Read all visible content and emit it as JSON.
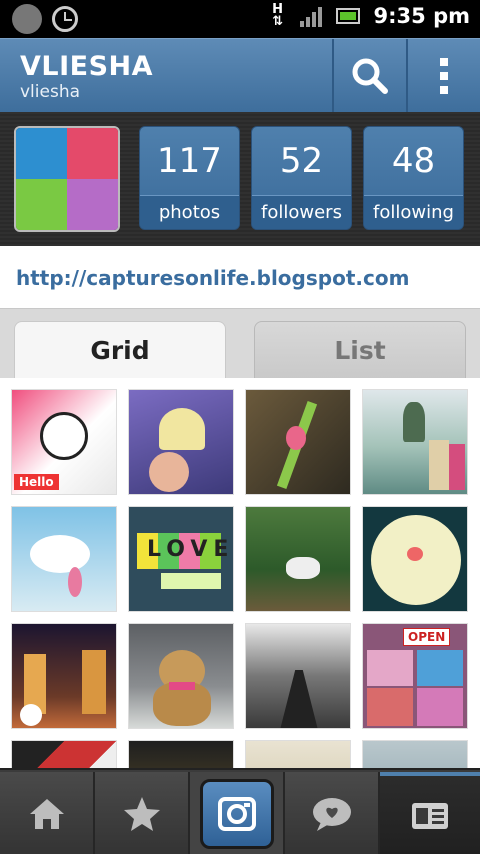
{
  "status_bar": {
    "network": "H",
    "time": "9:35 pm",
    "icons": [
      "smiley-icon",
      "alarm-clock-icon",
      "data-arrows-icon",
      "signal-icon",
      "battery-icon"
    ]
  },
  "header": {
    "display_name": "VLIESHA",
    "username": "vliesha",
    "icons": [
      "search-icon",
      "overflow-menu-icon"
    ],
    "color": "#4a7aaa"
  },
  "profile": {
    "stats": [
      {
        "count": "117",
        "label": "photos"
      },
      {
        "count": "52",
        "label": "followers"
      },
      {
        "count": "48",
        "label": "following"
      }
    ],
    "website": "http://capturesonlife.blogspot.com"
  },
  "tabs": {
    "grid_label": "Grid",
    "list_label": "List",
    "selected": "Grid"
  },
  "grid": {
    "photos": [
      {
        "name": "photo-panda-plush",
        "caption": "Hello"
      },
      {
        "name": "photo-heart-chip",
        "caption": ""
      },
      {
        "name": "photo-green-plant",
        "caption": ""
      },
      {
        "name": "photo-island-couple",
        "caption": ""
      },
      {
        "name": "photo-sky-flowers",
        "caption": ""
      },
      {
        "name": "photo-love-notes",
        "caption": "LOVE"
      },
      {
        "name": "photo-forest-statue",
        "caption": ""
      },
      {
        "name": "photo-plate-food",
        "caption": ""
      },
      {
        "name": "photo-night-building",
        "caption": ""
      },
      {
        "name": "photo-teddy-bear",
        "caption": ""
      },
      {
        "name": "photo-airport-walkway",
        "caption": ""
      },
      {
        "name": "photo-pillows-open-sign",
        "caption": "OPEN"
      },
      {
        "name": "photo-partial-1",
        "caption": ""
      },
      {
        "name": "photo-partial-2",
        "caption": ""
      },
      {
        "name": "photo-partial-3",
        "caption": ""
      },
      {
        "name": "photo-partial-4",
        "caption": ""
      }
    ]
  },
  "bottom_nav": {
    "items": [
      "home-icon",
      "star-icon",
      "camera-icon",
      "news-bubble-icon",
      "profile-card-icon"
    ],
    "active": "profile-card-icon"
  }
}
